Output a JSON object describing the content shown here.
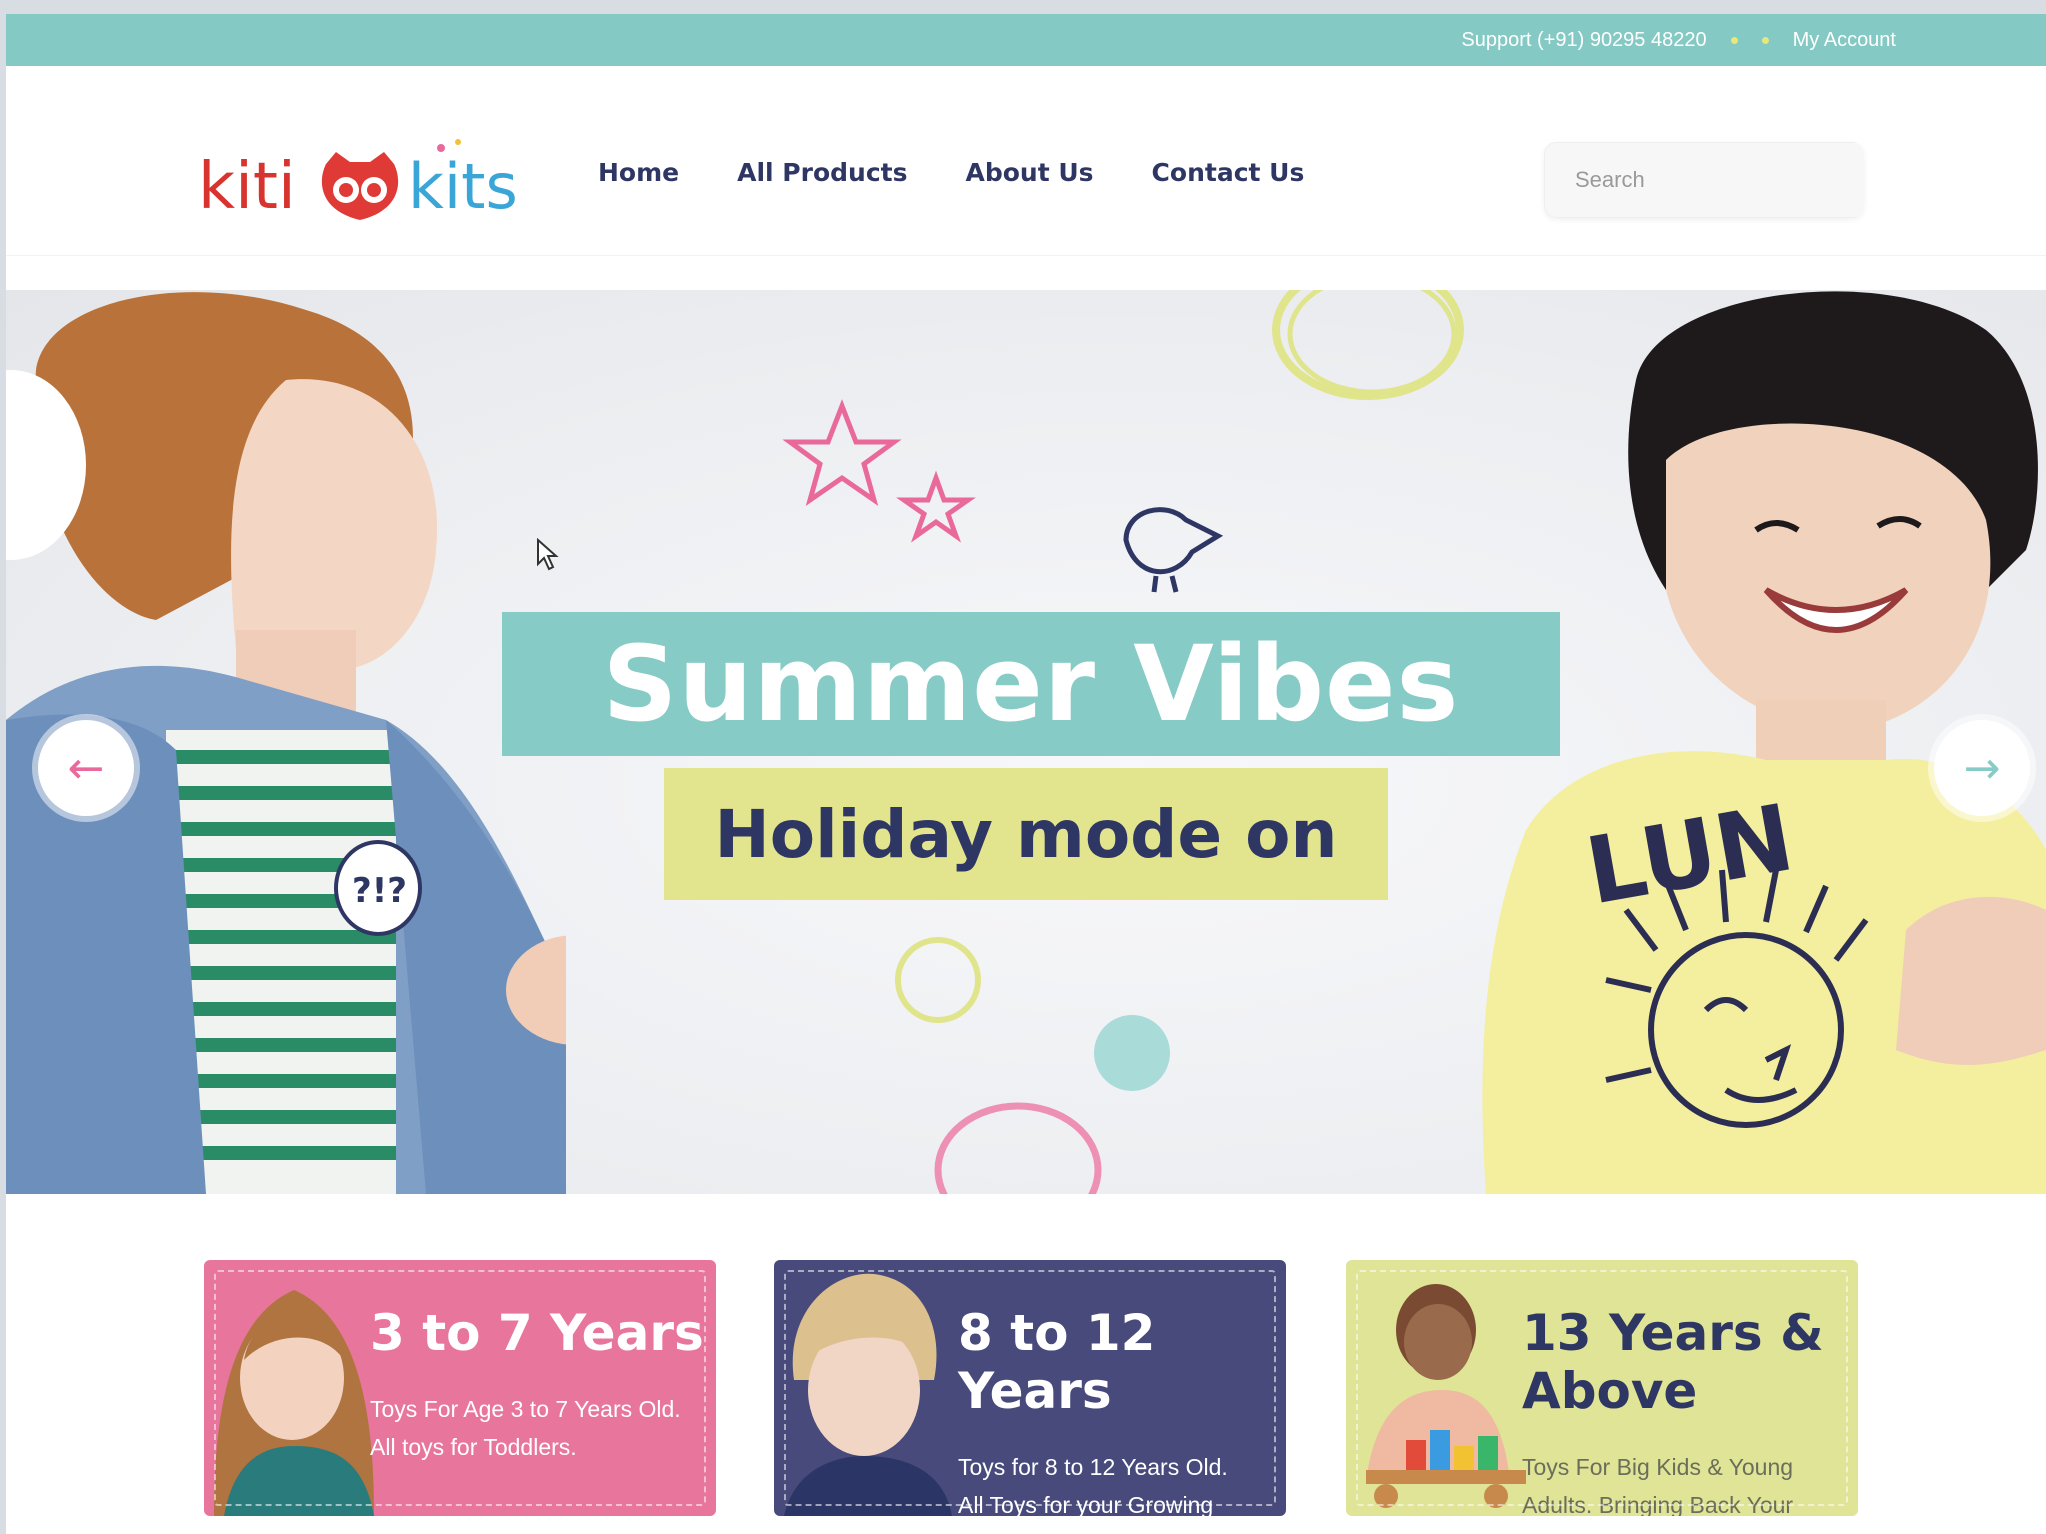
{
  "topbar": {
    "support": "Support (+91) 90295 48220",
    "account": "My Account"
  },
  "logo": {
    "text_left": "kiti",
    "text_right": "kits"
  },
  "nav": [
    {
      "label": "Home",
      "active": true
    },
    {
      "label": "All Products"
    },
    {
      "label": "About Us"
    },
    {
      "label": "Contact Us"
    }
  ],
  "search": {
    "placeholder": "Search"
  },
  "hero": {
    "title": "Summer Vibes",
    "subtitle": "Holiday mode on",
    "badge": "?!?"
  },
  "cards": [
    {
      "heading": "3 to 7 Years",
      "desc_line1": "Toys For Age 3 to 7 Years Old.",
      "desc_line2": "All toys for Toddlers."
    },
    {
      "heading_line1": "8 to 12",
      "heading_line2": "Years",
      "desc_line1": "Toys for 8 to 12 Years Old.",
      "desc_line2": "All Toys for your Growing"
    },
    {
      "heading_line1": "13 Years &",
      "heading_line2": "Above",
      "desc_line1": "Toys For Big Kids & Young",
      "desc_line2": "Adults. Bringing Back Your"
    }
  ],
  "colors": {
    "teal": "#85c9c4",
    "pink": "#e96a9a",
    "navy": "#2e3664",
    "lime": "#e2e48e",
    "purple": "#474a7a"
  }
}
